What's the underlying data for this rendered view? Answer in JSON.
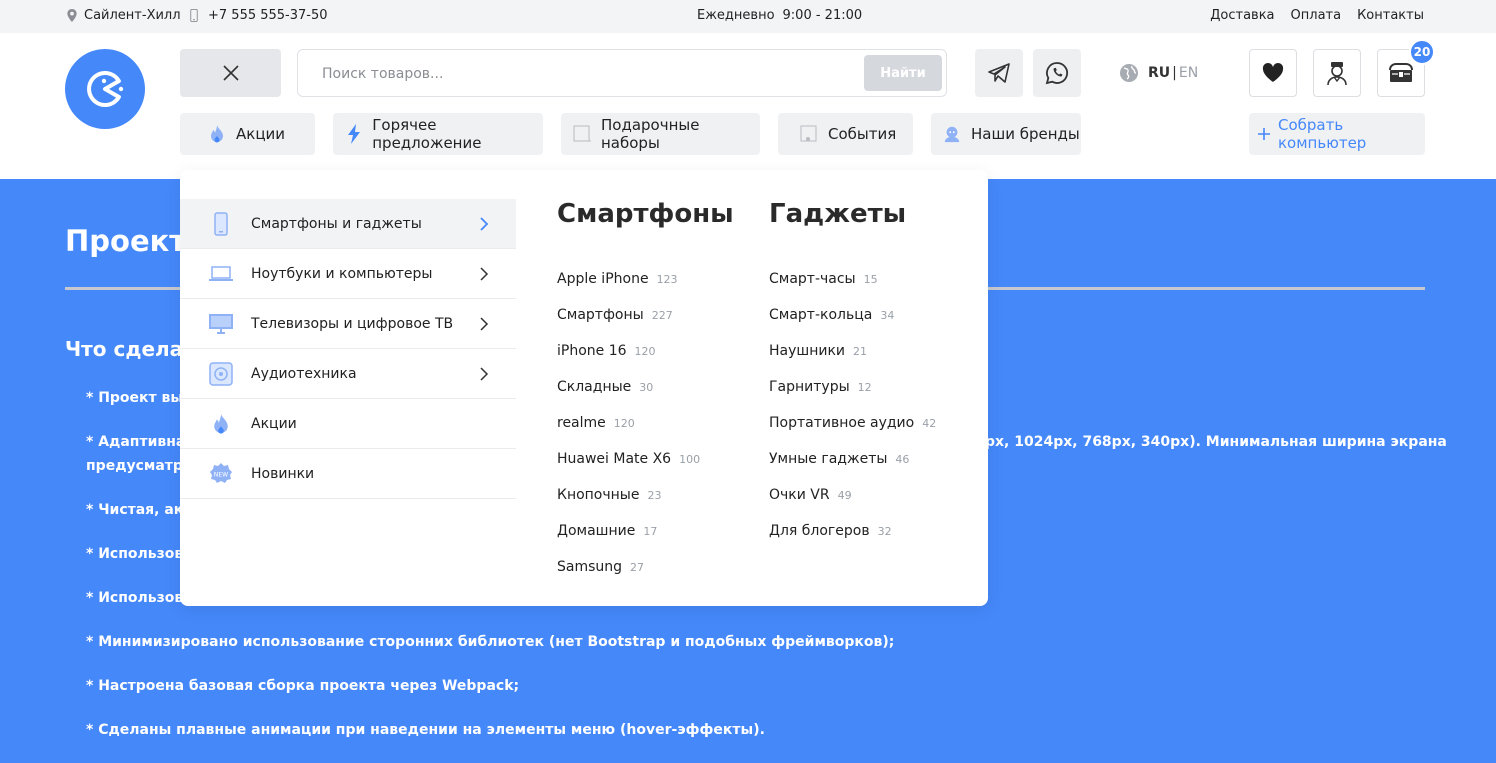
{
  "topbar": {
    "location": "Сайлент-Хилл",
    "phone": "+7 555 555-37-50",
    "hours_label": "Ежедневно",
    "hours_value": "9:00 - 21:00",
    "links": [
      "Доставка",
      "Оплата",
      "Контакты"
    ]
  },
  "header": {
    "search_placeholder": "Поиск товаров...",
    "search_button": "Найти",
    "lang_active": "RU",
    "lang_separator": "|",
    "lang_other": "EN",
    "cart_count": "20"
  },
  "nav": {
    "pills": [
      "Акции",
      "Горячее предложение",
      "Подарочные наборы",
      "События",
      "Наши бренды"
    ],
    "build_pc": "Собрать компьютер"
  },
  "menu": {
    "categories": [
      {
        "label": "Смартфоны и гаджеты",
        "icon": "smartphone-icon",
        "has_children": true,
        "active": true
      },
      {
        "label": "Ноутбуки и компьютеры",
        "icon": "laptop-icon",
        "has_children": true,
        "active": false
      },
      {
        "label": "Телевизоры и цифровое ТВ",
        "icon": "tv-icon",
        "has_children": true,
        "active": false
      },
      {
        "label": "Аудиотехника",
        "icon": "speaker-icon",
        "has_children": true,
        "active": false
      },
      {
        "label": "Акции",
        "icon": "fire-icon",
        "has_children": false,
        "active": false
      },
      {
        "label": "Новинки",
        "icon": "new-badge-icon",
        "has_children": false,
        "active": false
      }
    ],
    "columns": [
      {
        "title": "Смартфоны",
        "items": [
          {
            "label": "Apple iPhone",
            "count": "123"
          },
          {
            "label": "Смартфоны",
            "count": "227"
          },
          {
            "label": "iPhone 16",
            "count": "120"
          },
          {
            "label": "Складные",
            "count": "30"
          },
          {
            "label": "realme",
            "count": "120"
          },
          {
            "label": "Huawei Mate X6",
            "count": "100"
          },
          {
            "label": "Кнопочные",
            "count": "23"
          },
          {
            "label": "Домашние",
            "count": "17"
          },
          {
            "label": "Samsung",
            "count": "27"
          }
        ]
      },
      {
        "title": "Гаджеты",
        "items": [
          {
            "label": "Смарт-часы",
            "count": "15"
          },
          {
            "label": "Смарт-кольца",
            "count": "34"
          },
          {
            "label": "Наушники",
            "count": "21"
          },
          {
            "label": "Гарнитуры",
            "count": "12"
          },
          {
            "label": "Портативное аудио",
            "count": "42"
          },
          {
            "label": "Умные гаджеты",
            "count": "46"
          },
          {
            "label": "Очки VR",
            "count": "49"
          },
          {
            "label": "Для блогеров",
            "count": "32"
          }
        ]
      }
    ]
  },
  "hero": {
    "title": "Проект",
    "subtitle": "Что сделан",
    "bullets": [
      "* Проект вып",
      "* Адаптивная",
      "предусматри",
      "* Чистая, акк",
      "* Использова",
      "* Использова",
      "* Минимизировано использование сторонних библиотек (нет Bootstrap и подобных фреймворков);",
      "* Настроена базовая сборка проекта через Webpack;",
      "* Сделаны плавные анимации при наведении на элементы меню (hover-эффекты)."
    ],
    "adaptive_tail": "px, 1024px, 768px, 340px). Минимальная ширина экрана"
  },
  "colors": {
    "accent": "#4588fa",
    "topbar_bg": "#f3f4f6",
    "pill_bg": "#f0f1f3"
  }
}
